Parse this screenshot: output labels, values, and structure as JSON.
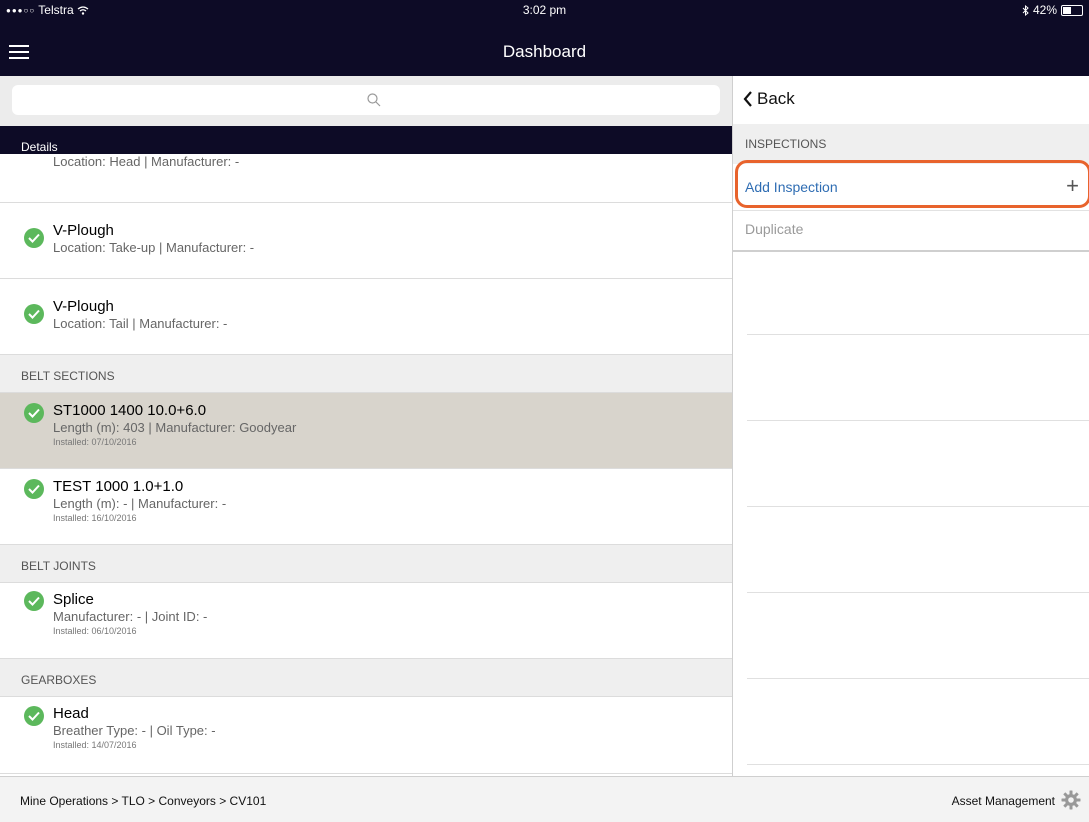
{
  "status_bar": {
    "signal_dots": "●●●○○",
    "carrier": "Telstra",
    "time": "3:02 pm",
    "battery_pct": "42%",
    "battery_level": 0.42
  },
  "nav": {
    "title": "Dashboard"
  },
  "details_bar": {
    "label": "Details",
    "clipped_sub": "Location: Head | Manufacturer: -"
  },
  "items_top": [
    {
      "name": "V-Plough",
      "sub": "Location: Take-up | Manufacturer: -"
    },
    {
      "name": "V-Plough",
      "sub": "Location: Tail | Manufacturer: -"
    }
  ],
  "sections": {
    "belt_sections": {
      "header": "BELT SECTIONS",
      "items": [
        {
          "name": "ST1000 1400 10.0+6.0",
          "sub": "Length (m): 403 | Manufacturer: Goodyear",
          "installed": "Installed: 07/10/2016"
        },
        {
          "name": "TEST 1000 1.0+1.0",
          "sub": "Length (m): - | Manufacturer: -",
          "installed": "Installed: 16/10/2016"
        }
      ]
    },
    "belt_joints": {
      "header": "BELT JOINTS",
      "items": [
        {
          "name": "Splice",
          "sub": "Manufacturer: - | Joint ID: -",
          "installed": "Installed: 06/10/2016"
        }
      ]
    },
    "gearboxes": {
      "header": "GEARBOXES",
      "items": [
        {
          "name": "Head",
          "sub": "Breather Type: - | Oil Type: -",
          "installed": "Installed: 14/07/2016"
        }
      ]
    }
  },
  "right_panel": {
    "back_label": "Back",
    "inspections_header": "INSPECTIONS",
    "add_inspection": "Add Inspection",
    "duplicate": "Duplicate"
  },
  "footer": {
    "breadcrumb": "Mine Operations > TLO > Conveyors > CV101",
    "asset_management": "Asset Management"
  },
  "colors": {
    "navbar": "#0d0b26",
    "check_green": "#5cb85c",
    "highlight_orange": "#e8632c",
    "link_blue": "#2f6db3",
    "selected_row": "#d8d4cc"
  }
}
